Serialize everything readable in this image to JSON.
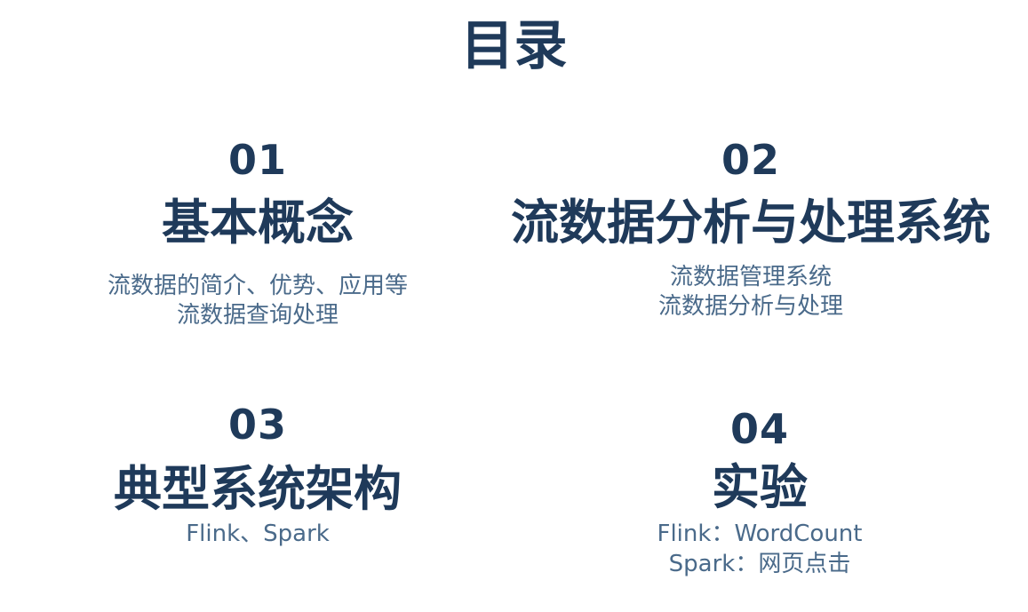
{
  "title": "目录",
  "sections": [
    {
      "number": "01",
      "heading": "基本概念",
      "lines": [
        "流数据的简介、优势、应用等",
        "流数据查询处理"
      ]
    },
    {
      "number": "02",
      "heading": "流数据分析与处理系统",
      "lines": [
        "流数据管理系统",
        "流数据分析与处理"
      ]
    },
    {
      "number": "03",
      "heading": "典型系统架构",
      "lines": [
        "Flink、Spark"
      ]
    },
    {
      "number": "04",
      "heading": "实验",
      "lines": [
        "Flink：WordCount",
        "Spark：网页点击"
      ]
    }
  ],
  "colors": {
    "heading": "#1f3a5a",
    "description": "#4a6a8a",
    "background": "#ffffff"
  }
}
